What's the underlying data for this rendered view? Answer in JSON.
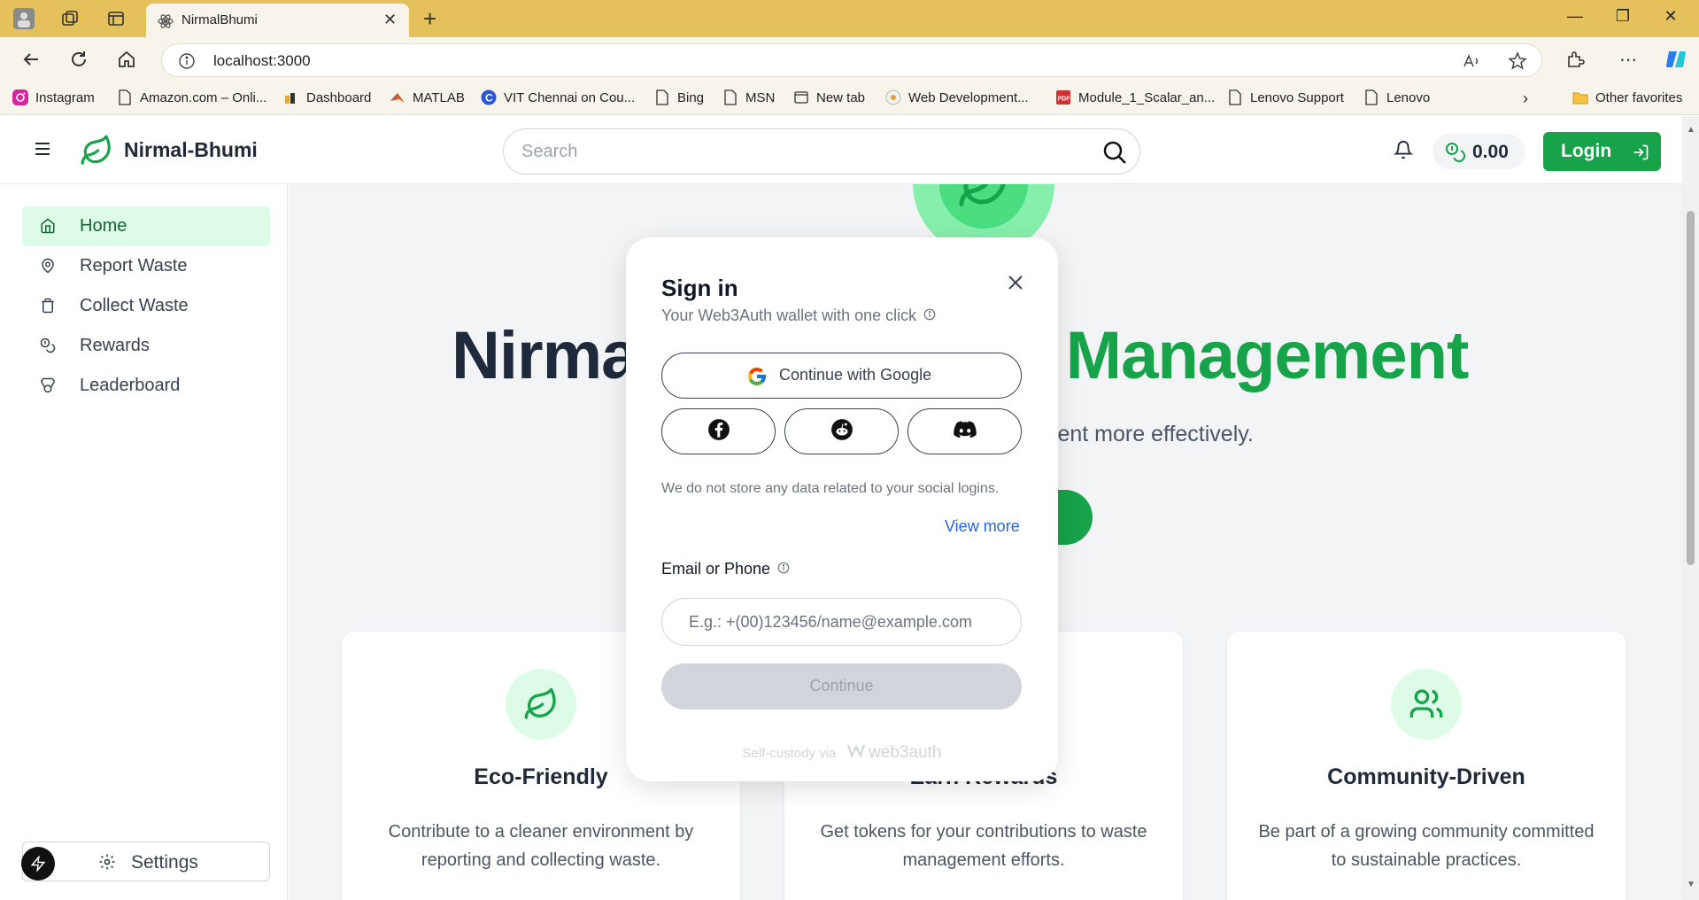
{
  "browser": {
    "tab_title": "NirmalBhumi",
    "url": "localhost:3000",
    "bookmarks": [
      {
        "label": "Instagram",
        "icon": "instagram-icon"
      },
      {
        "label": "Amazon.com – Onli...",
        "icon": "page-icon"
      },
      {
        "label": "Dashboard",
        "icon": "dashboard-icon"
      },
      {
        "label": "MATLAB",
        "icon": "matlab-icon"
      },
      {
        "label": "VIT Chennai on Cou...",
        "icon": "coursera-icon"
      },
      {
        "label": "Bing",
        "icon": "page-icon"
      },
      {
        "label": "MSN",
        "icon": "page-icon"
      },
      {
        "label": "New tab",
        "icon": "newtab-icon"
      },
      {
        "label": "Web Development...",
        "icon": "web-icon"
      },
      {
        "label": "Module_1_Scalar_an...",
        "icon": "pdf-icon"
      },
      {
        "label": "Lenovo Support",
        "icon": "page-icon"
      },
      {
        "label": "Lenovo",
        "icon": "page-icon"
      }
    ],
    "other_favorites": "Other favorites"
  },
  "header": {
    "brand": "Nirmal-Bhumi",
    "search_placeholder": "Search",
    "balance": "0.00",
    "login": "Login"
  },
  "sidebar": {
    "items": [
      {
        "label": "Home",
        "icon": "home-icon",
        "active": true
      },
      {
        "label": "Report Waste",
        "icon": "map-pin-icon",
        "active": false
      },
      {
        "label": "Collect Waste",
        "icon": "trash-icon",
        "active": false
      },
      {
        "label": "Rewards",
        "icon": "coins-icon",
        "active": false
      },
      {
        "label": "Leaderboard",
        "icon": "medal-icon",
        "active": false
      }
    ],
    "settings": "Settings"
  },
  "hero": {
    "title_left": "Nirma",
    "title_right": "e Management",
    "subtitle": "nagement more effectively."
  },
  "cards": [
    {
      "title": "Eco-Friendly",
      "desc": "Contribute to a cleaner environment by reporting and collecting waste.",
      "icon": "leaf-icon"
    },
    {
      "title": "Earn Rewards",
      "desc": "Get tokens for your contributions to waste management efforts.",
      "icon": "coins-icon"
    },
    {
      "title": "Community-Driven",
      "desc": "Be part of a growing community committed to sustainable practices.",
      "icon": "users-icon"
    }
  ],
  "modal": {
    "title": "Sign in",
    "subtitle": "Your Web3Auth wallet with one click",
    "google": "Continue with Google",
    "socials": [
      "facebook-icon",
      "reddit-icon",
      "discord-icon"
    ],
    "note": "We do not store any data related to your social logins.",
    "view_more": "View more",
    "email_label": "Email or Phone",
    "email_placeholder": "E.g.: +(00)123456/name@example.com",
    "continue": "Continue",
    "footer_prefix": "Self-custody via",
    "footer_brand": "web3auth"
  },
  "colors": {
    "accent": "#16a34a",
    "accent_light": "#dcfce7",
    "browser_frame": "#e4c15a",
    "link": "#2563eb"
  }
}
